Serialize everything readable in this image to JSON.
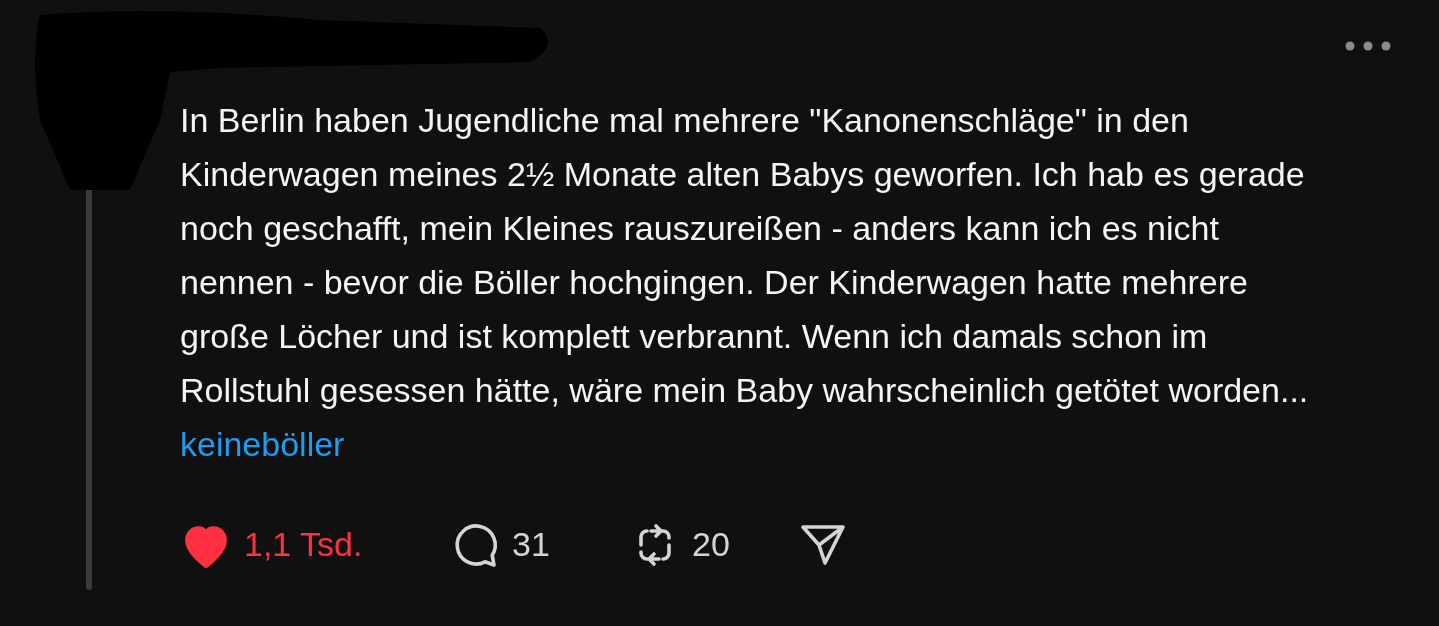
{
  "post": {
    "text_lines": [
      "In Berlin haben Jugendliche mal mehrere \"Kanonenschläge\" in den",
      "Kinderwagen meines 2½ Monate alten Babys geworfen. Ich hab es gerade",
      "noch geschafft, mein Kleines rauszureißen - anders kann ich es nicht",
      "nennen - bevor die Böller hochgingen. Der Kinderwagen hatte mehrere",
      "große Löcher und ist komplett verbrannt. Wenn ich damals schon im",
      "Rollstuhl gesessen hätte, wäre mein Baby wahrscheinlich getötet worden..."
    ],
    "hashtag": "keineböller",
    "actions": [
      {
        "kind": "like",
        "count": "1,1 Tsd.",
        "liked": true
      },
      {
        "kind": "reply",
        "count": "31"
      },
      {
        "kind": "repost",
        "count": "20"
      },
      {
        "kind": "share"
      }
    ]
  }
}
